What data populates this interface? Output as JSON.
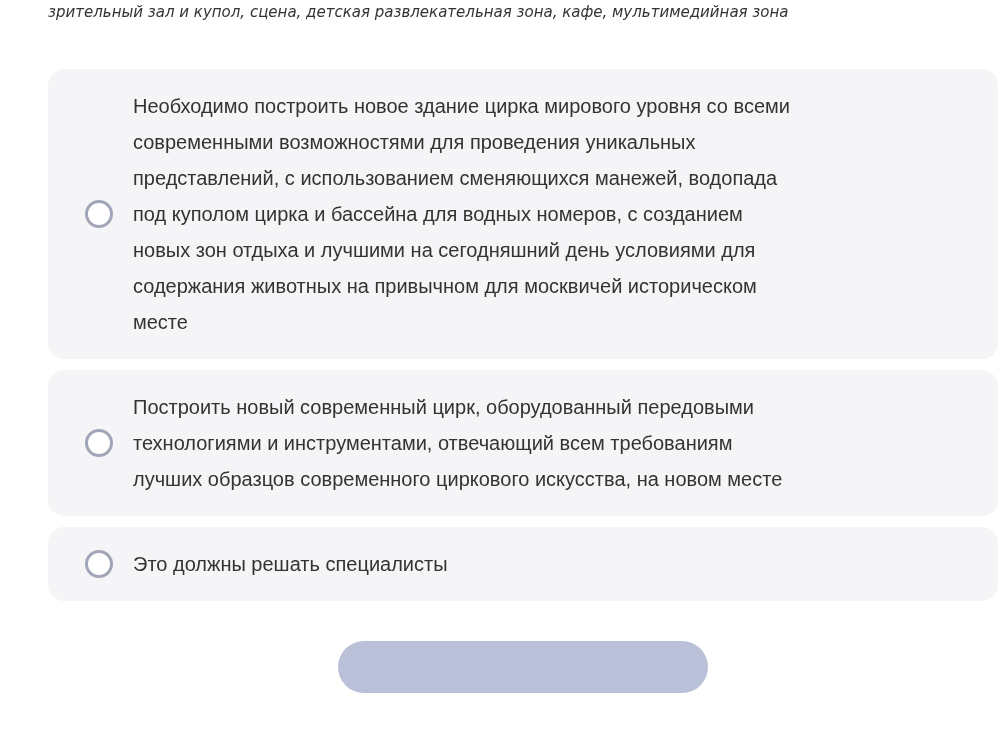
{
  "intro": "зрительный зал и купол, сцена, детская развлекательная зона, кафе, мультимедийная зона",
  "options": [
    {
      "label": "Необходимо построить новое здание цирка мирового уровня со всеми современными возможностями для проведения уникальных представлений, с использованием сменяющихся манежей, водопада под куполом цирка и бассейна для водных номеров, с созданием новых зон отдыха и лучшими на сегодняшний день условиями для содержания животных на привычном для москвичей историческом месте",
      "selected": false
    },
    {
      "label": "Построить новый современный цирк, оборудованный передовыми технологиями и инструментами, отвечающий всем требованиям лучших образцов современного циркового искусства, на новом месте",
      "selected": false
    },
    {
      "label": "Это должны решать специалисты",
      "selected": false
    }
  ]
}
